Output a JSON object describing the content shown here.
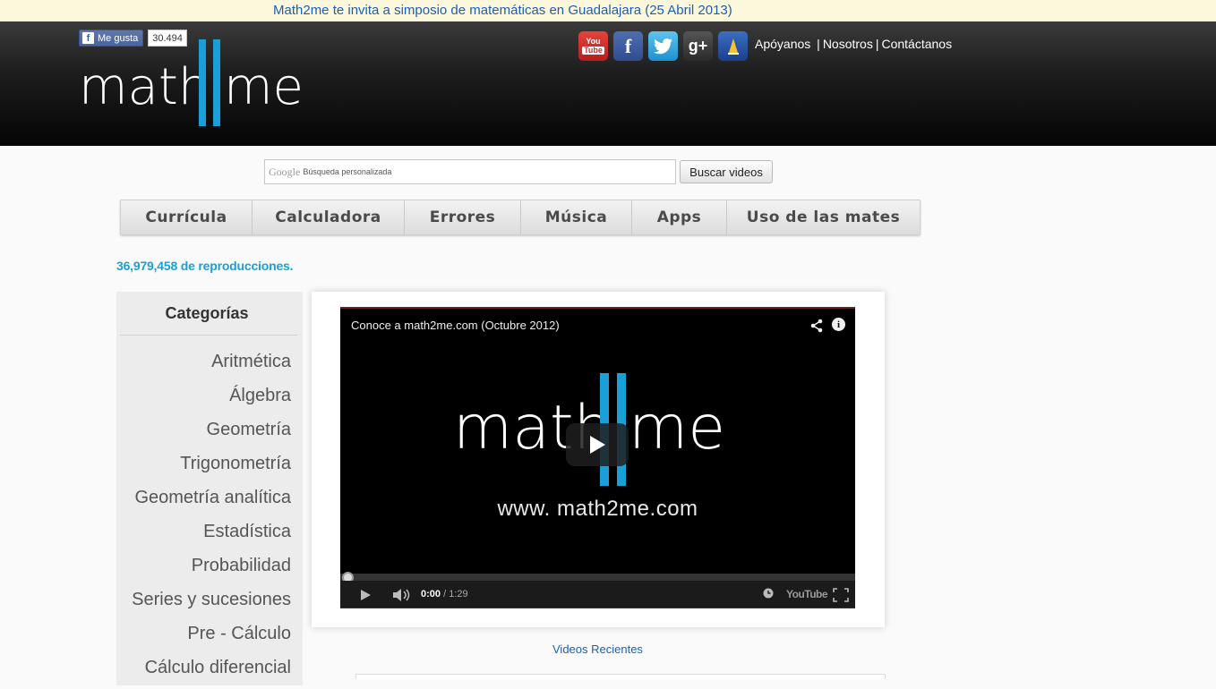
{
  "announcement": "Math2me te invita a simposio de matemáticas en Guadalajara (25 Abril 2013)",
  "facebook": {
    "like_label": "Me gusta",
    "count": "30.494"
  },
  "logo": {
    "left_text": "math",
    "right_text": "me"
  },
  "social_icons": [
    "youtube-icon",
    "facebook-icon",
    "twitter-icon",
    "google-plus-icon",
    "dailymotion-icon"
  ],
  "top_links": [
    "Apóyanos",
    "Nosotros",
    "Contáctanos"
  ],
  "search": {
    "placeholder": "Búsqueda personalizada",
    "google_label": "Google",
    "button": "Buscar videos"
  },
  "nav": [
    "Currícula",
    "Calculadora",
    "Errores",
    "Música",
    "Apps",
    "Uso de las mates"
  ],
  "views": "36,979,458 de reproducciones.",
  "sidebar": {
    "title": "Categorías",
    "items": [
      "Aritmética",
      "Álgebra",
      "Geometría",
      "Trigonometría",
      "Geometría analítica",
      "Estadística",
      "Probabilidad",
      "Series y sucesiones",
      "Pre - Cálculo",
      "Cálculo diferencial"
    ]
  },
  "video": {
    "title": "Conoce a math2me.com (Octubre 2012)",
    "url_text": "www. math2me.com",
    "current_time": "0:00",
    "duration": "/ 1:29",
    "brand": "YouTube"
  },
  "recent_label": "Videos Recientes",
  "colors": {
    "accent_blue": "#1aa0d8",
    "link_blue": "#1a5fb4",
    "header_black": "#050505"
  }
}
